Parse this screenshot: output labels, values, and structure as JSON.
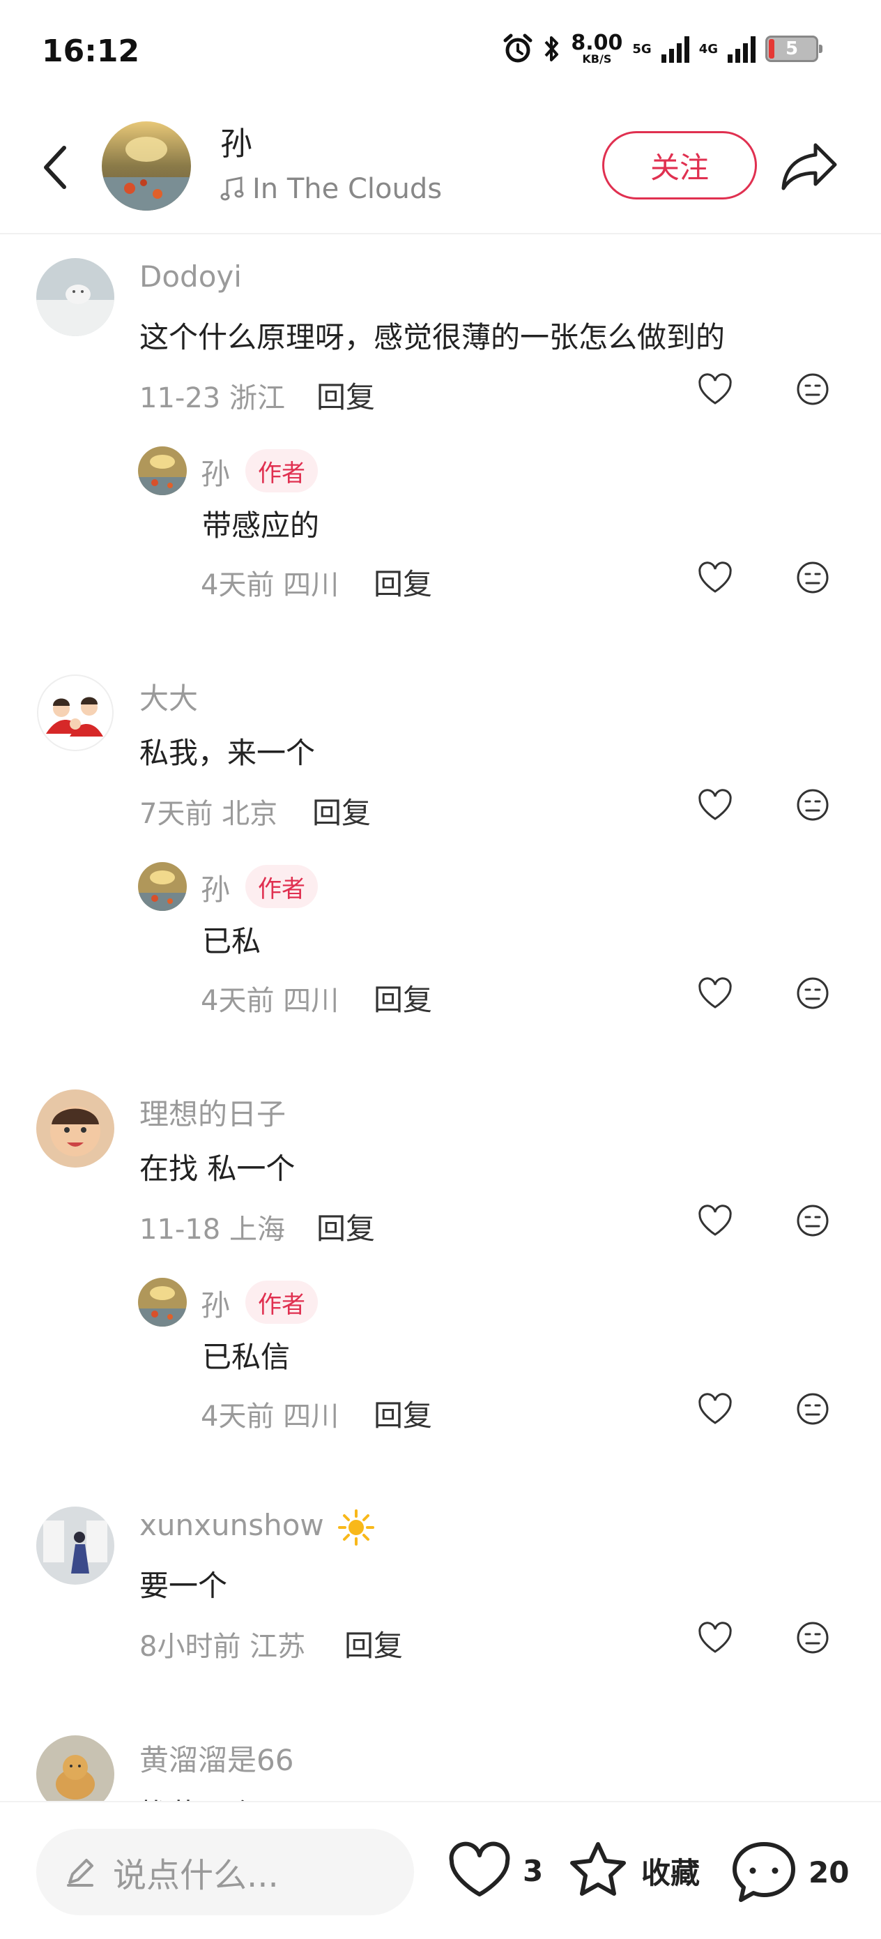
{
  "status_bar": {
    "time": "16:12",
    "speed_value": "8.00",
    "speed_unit": "KB/S",
    "net_5g": "5G",
    "net_4g": "4G",
    "battery": "5",
    "icons": [
      "alarm-icon",
      "bluetooth-icon",
      "signal-icon",
      "battery-icon"
    ]
  },
  "header": {
    "author_name": "孙",
    "music_title": "In The Clouds",
    "follow_label": "关注",
    "icons": [
      "back-icon",
      "music-note-icon",
      "share-icon"
    ],
    "accent_color": "#e03050"
  },
  "comments": [
    {
      "user": "Dodoyi",
      "text": "这个什么原理呀，感觉很薄的一张怎么做到的",
      "time_location": "11-23 浙江",
      "reply_label": "回复",
      "author_reply": {
        "user": "孙",
        "badge": "作者",
        "text": "带感应的",
        "time_location": "4天前 四川",
        "reply_label": "回复"
      }
    },
    {
      "user": "大大",
      "text": "私我，来一个",
      "time_location": "7天前 北京",
      "reply_label": "回复",
      "author_reply": {
        "user": "孙",
        "badge": "作者",
        "text": "已私",
        "time_location": "4天前 四川",
        "reply_label": "回复"
      }
    },
    {
      "user": "理想的日子",
      "text": "在找 私一个",
      "time_location": "11-18 上海",
      "reply_label": "回复",
      "author_reply": {
        "user": "孙",
        "badge": "作者",
        "text": "已私信",
        "time_location": "4天前 四川",
        "reply_label": "回复"
      }
    },
    {
      "user": "xunxunshow",
      "text": "要一个",
      "time_location": "8小时前 江苏",
      "reply_label": "回复"
    },
    {
      "user": "黄溜溜是66",
      "text": "找花一个"
    }
  ],
  "bottom_bar": {
    "input_placeholder": "说点什么...",
    "like_count": "3",
    "collect_label": "收藏",
    "comment_count": "20",
    "icons": [
      "pencil-icon",
      "heart-icon",
      "star-icon",
      "comment-bubble-icon"
    ]
  }
}
